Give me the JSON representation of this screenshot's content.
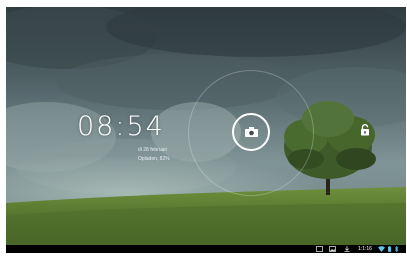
{
  "lockscreen": {
    "time": "08:54",
    "date": "di 28 februari",
    "status": "Opladen, 82%"
  },
  "targets": {
    "camera": "camera-icon",
    "unlock": "unlock-icon"
  },
  "system_bar": {
    "clock": "1:1:16",
    "icons": [
      "screenshot-icon",
      "gallery-icon",
      "download-icon",
      "wifi-icon",
      "battery-icon",
      "bluetooth-icon"
    ]
  },
  "colors": {
    "ring": "#ffffff",
    "system_bar": "#000000",
    "wifi": "#5fc2e8"
  }
}
